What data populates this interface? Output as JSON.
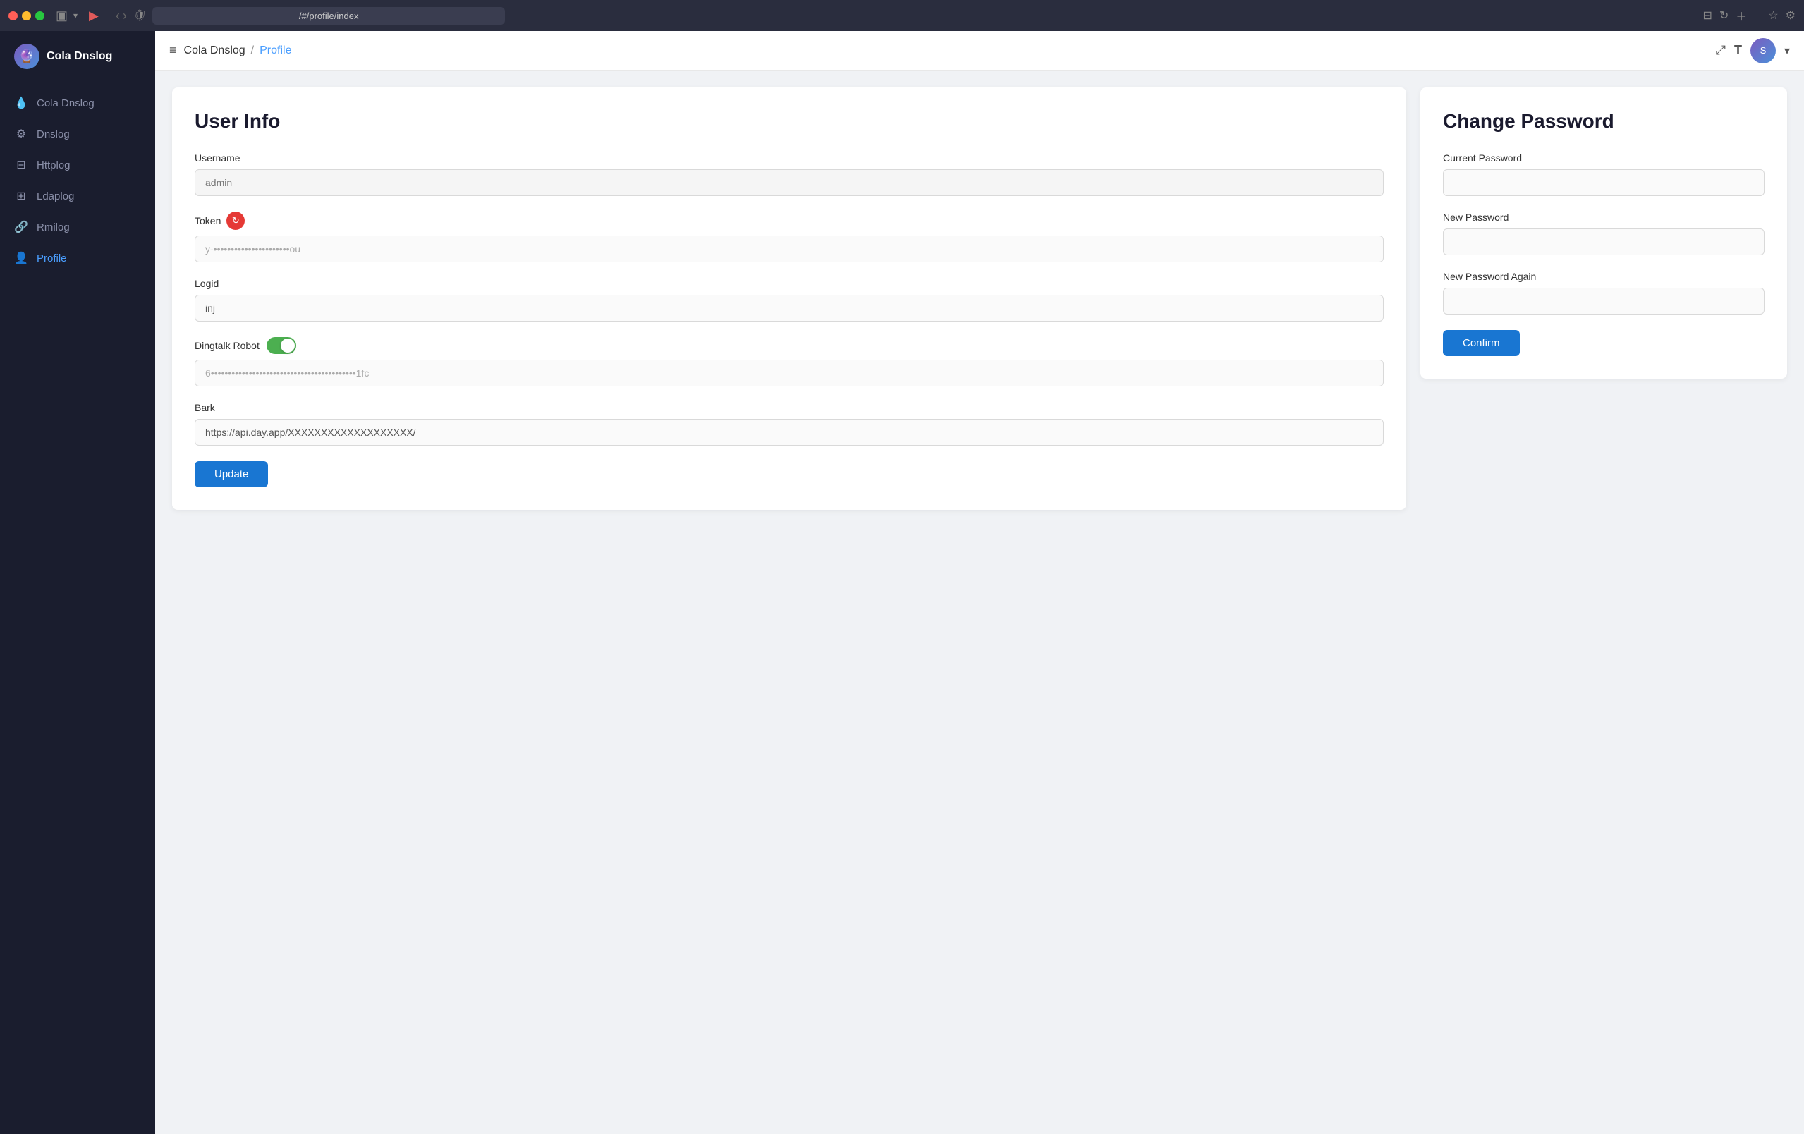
{
  "titlebar": {
    "url": "/#/profile/index",
    "sidebar_icon": "▣",
    "nav_back": "‹",
    "nav_forward": "›"
  },
  "sidebar": {
    "app_name": "Cola Dnslog",
    "logo_emoji": "🔮",
    "items": [
      {
        "id": "cola-dnslog",
        "label": "Cola Dnslog",
        "icon": "💧",
        "active": false
      },
      {
        "id": "dnslog",
        "label": "Dnslog",
        "icon": "⚙",
        "active": false
      },
      {
        "id": "httplog",
        "label": "Httplog",
        "icon": "⊟",
        "active": false
      },
      {
        "id": "ldaplog",
        "label": "Ldaplog",
        "icon": "⊞",
        "active": false
      },
      {
        "id": "rmilog",
        "label": "Rmilog",
        "icon": "🔗",
        "active": false
      },
      {
        "id": "profile",
        "label": "Profile",
        "icon": "👤",
        "active": true
      }
    ]
  },
  "topbar": {
    "menu_icon": "≡",
    "app_name": "Cola Dnslog",
    "separator": "/",
    "current_page": "Profile",
    "expand_icon": "⤢",
    "font_icon": "T",
    "avatar_text": "S"
  },
  "user_info": {
    "title": "User Info",
    "username_label": "Username",
    "username_placeholder": "admin",
    "token_label": "Token",
    "token_value": "y-••••••••••••••••••••••ou",
    "logid_label": "Logid",
    "logid_value": "inj",
    "dingtalk_label": "Dingtalk Robot",
    "dingtalk_value": "6••••••••••••••••••••••••••••••••••••••••••1fc",
    "bark_label": "Bark",
    "bark_value": "https://api.day.app/XXXXXXXXXXXXXXXXXXX/",
    "update_btn": "Update"
  },
  "change_password": {
    "title": "Change Password",
    "current_password_label": "Current Password",
    "new_password_label": "New Password",
    "new_password_again_label": "New Password Again",
    "confirm_btn": "Confirm"
  }
}
